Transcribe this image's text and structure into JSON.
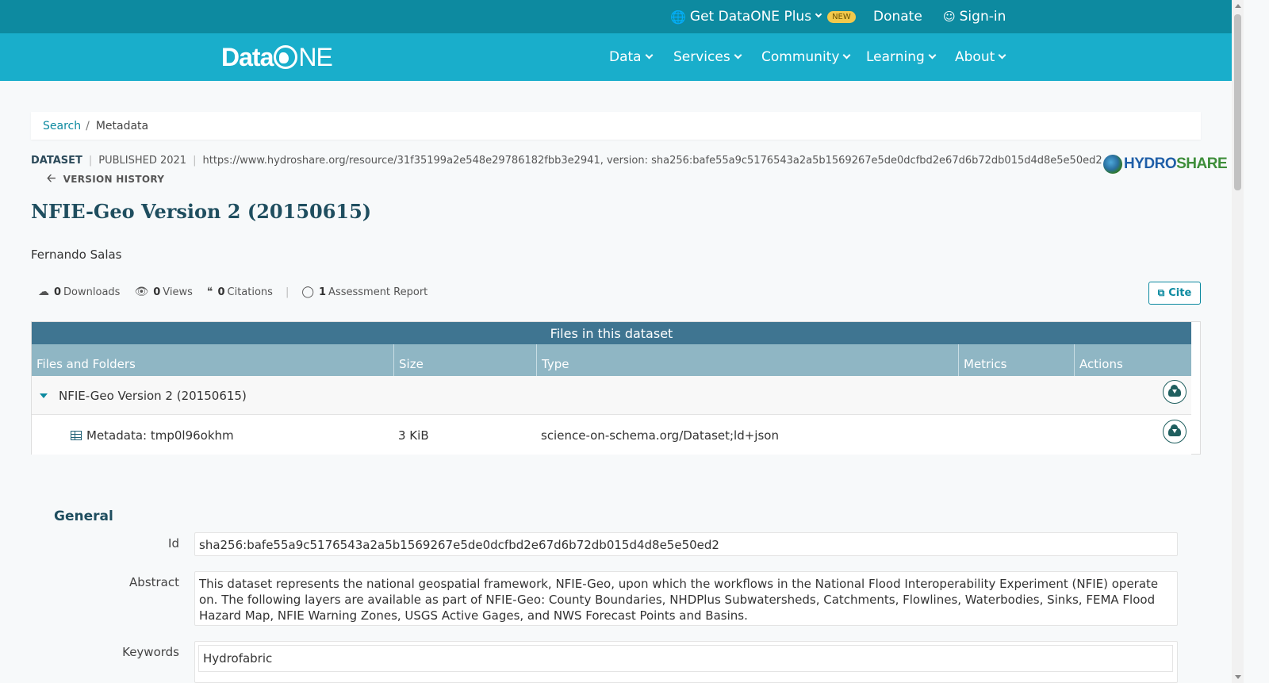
{
  "topbar": {
    "plus_label": "Get DataONE Plus",
    "new_badge": "NEW",
    "donate_label": "Donate",
    "signin_label": "Sign-in"
  },
  "nav": {
    "logo": {
      "left": "Data",
      "right": "NE"
    },
    "items": [
      "Data",
      "Services",
      "Community",
      "Learning",
      "About"
    ]
  },
  "breadcrumb": {
    "search": "Search",
    "separator": "/",
    "current": "Metadata"
  },
  "dataset": {
    "type_label": "DATASET",
    "published": "PUBLISHED 2021",
    "identifier": "https://www.hydroshare.org/resource/31f35199a2e548e29786182fbb3e2941, version: sha256:bafe55a9c5176543a2a5b1569267e5de0dcfbd2e67d6b72db015d4d8e5e50ed2",
    "version_history": "VERSION HISTORY",
    "repo_logo": {
      "part1": "HYDRO",
      "part2": "SHARE"
    },
    "title": "NFIE-Geo Version 2 (20150615)",
    "author": "Fernando Salas"
  },
  "metrics": {
    "downloads": {
      "count": "0",
      "label": "Downloads"
    },
    "views": {
      "count": "0",
      "label": "Views"
    },
    "citations": {
      "count": "0",
      "label": "Citations"
    },
    "assessment": {
      "count": "1",
      "label": "Assessment Report"
    },
    "cite_label": "Cite"
  },
  "files": {
    "heading": "Files in this dataset",
    "columns": [
      "Files and Folders",
      "Size",
      "Type",
      "Metrics",
      "Actions"
    ],
    "folder": {
      "name": "NFIE-Geo Version 2 (20150615)"
    },
    "file": {
      "name": "Metadata: tmp0l96okhm",
      "size": "3 KiB",
      "type": "science-on-schema.org/Dataset;ld+json"
    }
  },
  "general": {
    "heading": "General",
    "id_label": "Id",
    "id_value": "sha256:bafe55a9c5176543a2a5b1569267e5de0dcfbd2e67d6b72db015d4d8e5e50ed2",
    "abstract_label": "Abstract",
    "abstract_value": "This dataset represents the national geospatial framework, NFIE-Geo, upon which the workflows in the National Flood Interoperability Experiment (NFIE) operate on. The following layers are available as part of NFIE-Geo: County Boundaries, NHDPlus Subwatersheds, Catchments, Flowlines, Waterbodies, Sinks, FEMA Flood Hazard Map, NFIE Warning Zones, USGS Active Gages, and NWS Forecast Points and Basins.",
    "keywords_label": "Keywords",
    "keywords_value": "Hydrofabric"
  },
  "colors": {
    "topbar": "#0d8aa0",
    "nav": "#19aecb",
    "table_header": "#3f7591",
    "column_header": "#8fb6c4",
    "accent": "#0d8aa0"
  }
}
